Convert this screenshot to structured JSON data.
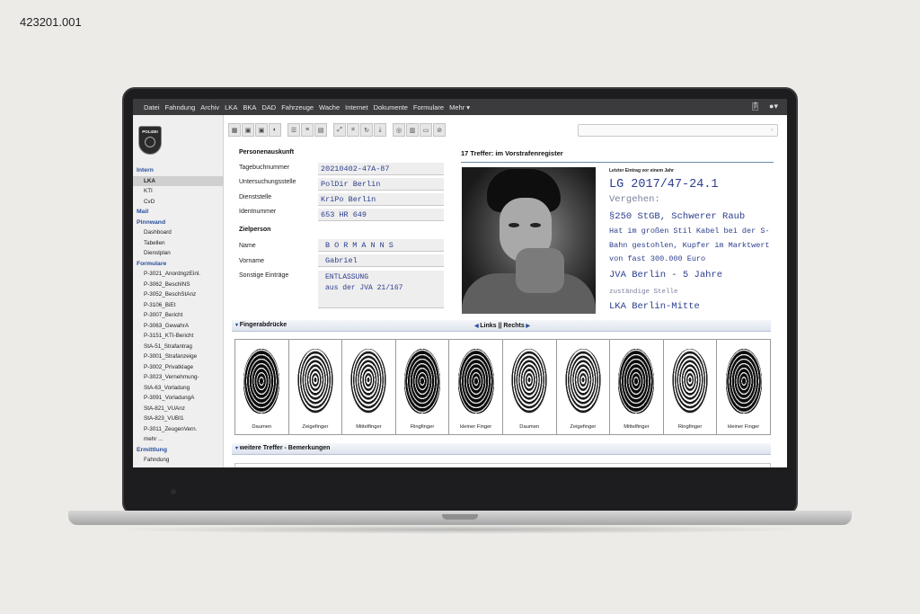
{
  "stock_id": "423201.001",
  "menu": [
    "Datei",
    "Fahndung",
    "Archiv",
    "LKA",
    "BKA",
    "DAD",
    "Fahrzeuge",
    "Wache",
    "Internet",
    "Dokumente",
    "Formulare",
    "Mehr ▾"
  ],
  "menu_icons": {
    "clipboard": "clipboard-icon",
    "user": "user-icon"
  },
  "logo_text": "POLIZEI",
  "sidebar": {
    "groups": [
      {
        "head": "Intern",
        "items": [
          "LKA",
          "KTI",
          "CvD"
        ],
        "active": "LKA"
      },
      {
        "head": "Mail",
        "items": []
      },
      {
        "head": "Pinnwand",
        "items": [
          "Dashboard",
          "Tabellen",
          "Dienstplan"
        ]
      },
      {
        "head": "Formulare",
        "items": [
          "P-3021_AnordngzEinl.",
          "P-3062_BeschlNS",
          "P-3052_BeschStAnz",
          "P-3106_BiEt",
          "P-3007_Bericht",
          "P-3063_GewahrA",
          "P-3151_KTI-Bericht",
          "StA-51_Strafantrag",
          "P-3001_Strafanzeige",
          "P-3002_Privatklage",
          "P-3023_Vernehmung-",
          "StA-63_Vorladung",
          "P-3091_VorladungA",
          "StA-821_VUAnz",
          "StA-823_VUBI1",
          "P-3011_ZeugenVern.",
          "mehr ..."
        ]
      },
      {
        "head": "Ermittlung",
        "items": [
          "Fahndung"
        ]
      }
    ]
  },
  "toolbar_icons": [
    "grid-icon",
    "image-icon",
    "image-icon",
    "contrast-icon",
    "list-icon",
    "sort-icon",
    "clipboard-icon",
    "expand-icon",
    "crop-icon",
    "rotate-icon",
    "download-icon",
    "fingerprint-icon",
    "delete-icon",
    "print-icon",
    "attach-icon"
  ],
  "search": {
    "placeholder": "",
    "hint": "⌕"
  },
  "person": {
    "section": "Personenauskunft",
    "fields": [
      {
        "label": "Tagebuchnummer",
        "value": "20210402-47A-87"
      },
      {
        "label": "Untersuchungsstelle",
        "value": "PolDir Berlin"
      },
      {
        "label": "Dienststelle",
        "value": "KriPo Berlin"
      },
      {
        "label": "Identnummer",
        "value": "653 HR 649"
      }
    ],
    "target_section": "Zielperson",
    "name_label": "Name",
    "name_value": "BORMANNS",
    "first_label": "Vorname",
    "first_value": "Gabriel",
    "other_label": "Sonstige Einträge",
    "other_value": "ENTLASSUNG\naus der JVA 21/167"
  },
  "record": {
    "hits": "17 Treffer:  im Vorstrafenregister",
    "note": "Letzter Eintrag vor einem Jahr",
    "case": "LG 2017/47-24.1",
    "offense_label": "Vergehen:",
    "offense": "§250 StGB, Schwerer Raub",
    "description": "Hat im großen Stil Kabel bei der S-Bahn gestohlen, Kupfer im Marktwert von fast 300.000 Euro",
    "sentence": "JVA Berlin - 5 Jahre",
    "authority_label": "zuständige Stelle",
    "authority": "LKA Berlin-Mitte"
  },
  "fingerprints": {
    "title": "Fingerabdrücke",
    "switch": "Links || Rechts",
    "fingers": [
      "Daumen",
      "Zeigefinger",
      "Mittelfinger",
      "Ringfinger",
      "kleiner Finger",
      "Daumen",
      "Zeigefinger",
      "Mittelfinger",
      "Ringfinger",
      "kleiner Finger"
    ],
    "dark": [
      true,
      false,
      false,
      true,
      true,
      false,
      false,
      true,
      false,
      true
    ]
  },
  "more": {
    "title": "weitere Treffer - Bemerkungen"
  }
}
